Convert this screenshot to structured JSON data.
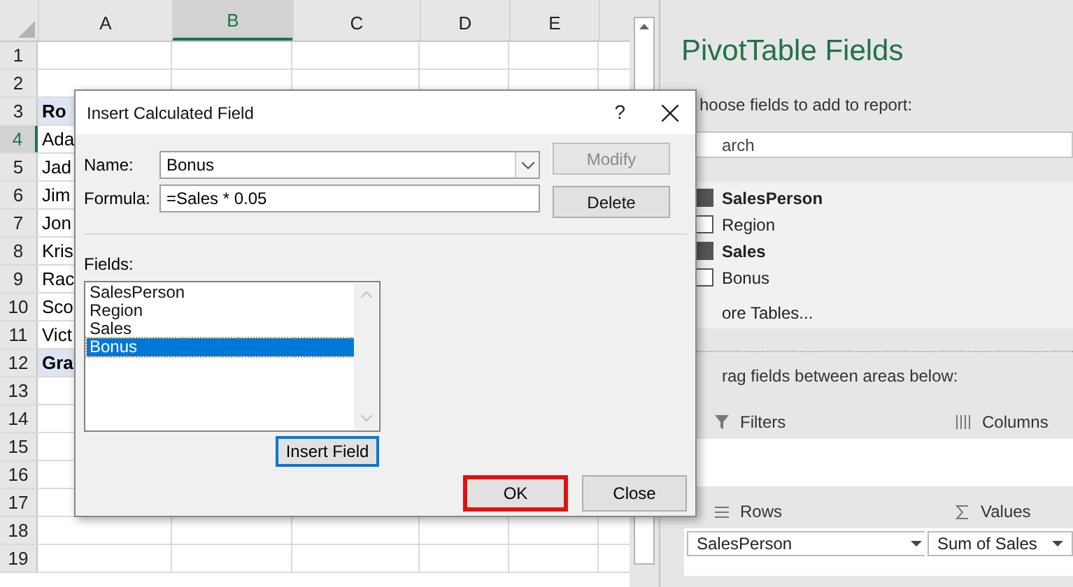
{
  "sheet": {
    "columns": [
      {
        "label": "A",
        "selected": false
      },
      {
        "label": "B",
        "selected": true
      },
      {
        "label": "C",
        "selected": false
      },
      {
        "label": "D",
        "selected": false
      },
      {
        "label": "E",
        "selected": false
      }
    ],
    "rows": [
      {
        "number": "1",
        "selected": false,
        "kind": "blank"
      },
      {
        "number": "2",
        "selected": false,
        "kind": "blank"
      },
      {
        "number": "3",
        "selected": false,
        "kind": "heading",
        "cell_a": "Ro"
      },
      {
        "number": "4",
        "selected": true,
        "kind": "item",
        "cell_a": "Ada"
      },
      {
        "number": "5",
        "selected": false,
        "kind": "item",
        "cell_a": "Jad"
      },
      {
        "number": "6",
        "selected": false,
        "kind": "item",
        "cell_a": "Jim"
      },
      {
        "number": "7",
        "selected": false,
        "kind": "item",
        "cell_a": "Jon"
      },
      {
        "number": "8",
        "selected": false,
        "kind": "item",
        "cell_a": "Kris"
      },
      {
        "number": "9",
        "selected": false,
        "kind": "item",
        "cell_a": "Rac"
      },
      {
        "number": "10",
        "selected": false,
        "kind": "item",
        "cell_a": "Sco"
      },
      {
        "number": "11",
        "selected": false,
        "kind": "item",
        "cell_a": "Vict"
      },
      {
        "number": "12",
        "selected": false,
        "kind": "heading",
        "cell_a": "Gra"
      },
      {
        "number": "13",
        "selected": false,
        "kind": "blank"
      },
      {
        "number": "14",
        "selected": false,
        "kind": "blank"
      },
      {
        "number": "15",
        "selected": false,
        "kind": "blank"
      },
      {
        "number": "16",
        "selected": false,
        "kind": "blank"
      },
      {
        "number": "17",
        "selected": false,
        "kind": "blank"
      },
      {
        "number": "18",
        "selected": false,
        "kind": "blank"
      },
      {
        "number": "19",
        "selected": false,
        "kind": "blank"
      }
    ]
  },
  "dialog": {
    "title": "Insert Calculated Field",
    "help": "?",
    "name_label": "Name:",
    "name_value": "Bonus",
    "formula_label": "Formula:",
    "formula_value": "=Sales * 0.05",
    "modify_button": {
      "label": "Modify",
      "disabled": true
    },
    "delete_button": {
      "label": "Delete",
      "disabled": false
    },
    "fields_label": "Fields:",
    "fields": [
      {
        "label": "SalesPerson",
        "selected": false
      },
      {
        "label": "Region",
        "selected": false
      },
      {
        "label": "Sales",
        "selected": false
      },
      {
        "label": "Bonus",
        "selected": true
      }
    ],
    "insert_field_button": {
      "label": "Insert Field",
      "focused": true
    },
    "ok_button": {
      "label": "OK",
      "highlighted": true
    },
    "close_button": {
      "label": "Close",
      "highlighted": false
    }
  },
  "panel": {
    "title": "PivotTable Fields",
    "instruction": "hoose fields to add to report:",
    "search": {
      "placeholder": "arch"
    },
    "fields": [
      {
        "label": "SalesPerson",
        "checked": true
      },
      {
        "label": "Region",
        "checked": false
      },
      {
        "label": "Sales",
        "checked": true
      },
      {
        "label": "Bonus",
        "checked": false
      }
    ],
    "more_tables": "ore Tables...",
    "drag_hint": "rag fields between areas below:",
    "areas": [
      {
        "name": "Filters",
        "kind": "filters"
      },
      {
        "name": "Columns",
        "kind": "columns"
      },
      {
        "name": "Rows",
        "kind": "rows",
        "items": [
          "SalesPerson"
        ]
      },
      {
        "name": "Values",
        "kind": "values",
        "items": [
          "Sum of Sales"
        ]
      }
    ]
  }
}
